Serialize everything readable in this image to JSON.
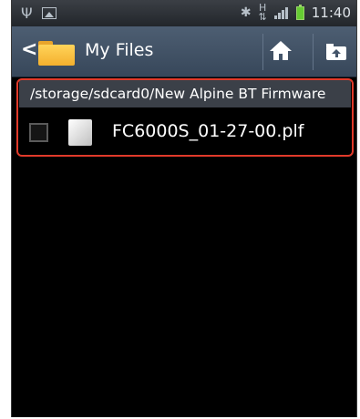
{
  "status_bar": {
    "icons_left": [
      "usb-icon",
      "gallery-icon"
    ],
    "icons_right": [
      "bluetooth-icon",
      "ht-data-icon",
      "signal-icon",
      "battery-charging-icon"
    ],
    "ht_text": "H",
    "time": "11:40"
  },
  "action_bar": {
    "title": "My Files",
    "back_glyph": "<",
    "actions": [
      "home-icon",
      "up-folder-icon"
    ]
  },
  "path": "/storage/sdcard0/New Alpine BT Firmware",
  "files": [
    {
      "name": "FC6000S_01-27-00.plf",
      "checked": false
    }
  ],
  "colors": {
    "action_bar": "#44556a",
    "status_bar": "#2b2f34",
    "path_bar": "#3b4048",
    "highlight": "#e13a2a",
    "folder": "#f4b02d",
    "battery": "#66cc33"
  }
}
